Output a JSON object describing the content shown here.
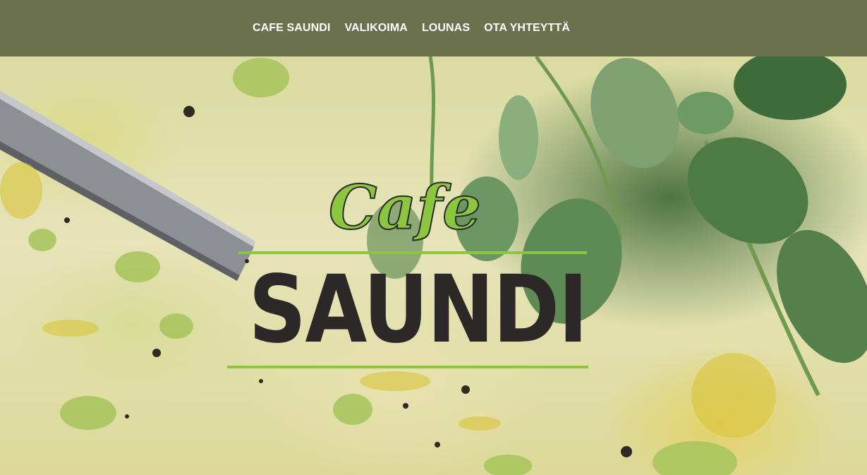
{
  "nav": {
    "items": [
      {
        "label": "CAFE SAUNDI"
      },
      {
        "label": "VALIKOIMA"
      },
      {
        "label": "LOUNAS"
      },
      {
        "label": "OTA YHTEYTTÄ"
      }
    ]
  },
  "hero": {
    "logo": {
      "line1": "Cafe",
      "line2": "SAUNDI"
    }
  },
  "colors": {
    "header_bg": "#6b704d",
    "logo_green": "#8cc63f",
    "logo_dark": "#2b2827"
  }
}
